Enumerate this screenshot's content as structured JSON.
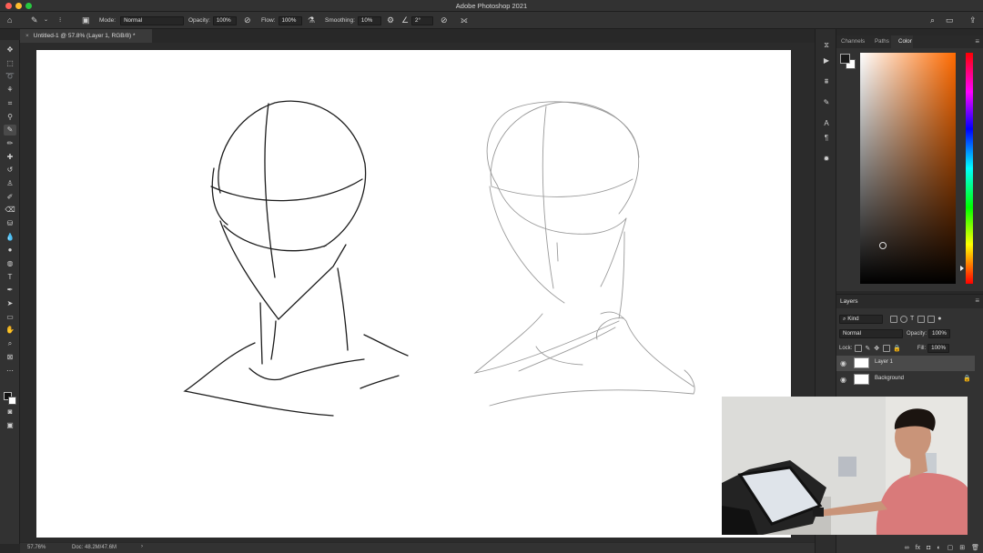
{
  "app": {
    "title": "Adobe Photoshop 2021"
  },
  "options_bar": {
    "mode_label": "Mode:",
    "mode_value": "Normal",
    "opacity_label": "Opacity:",
    "opacity_value": "100%",
    "flow_label": "Flow:",
    "flow_value": "100%",
    "smoothing_label": "Smoothing:",
    "smoothing_value": "10%",
    "angle_value": "2°"
  },
  "document": {
    "tab_title": "Untitled-1 @ 57.8% (Layer 1, RGB/8) *"
  },
  "status": {
    "zoom": "57.76%",
    "doc_info": "Doc: 48.2M/47.6M"
  },
  "color_panel": {
    "tabs": [
      "Channels",
      "Paths",
      "Color"
    ],
    "active_tab": "Color",
    "foreground": "#1a1a1a",
    "background": "#ffffff",
    "hue": "#ff6a00"
  },
  "layers_panel": {
    "title": "Layers",
    "filter_value": "Kind",
    "blend_mode": "Normal",
    "opacity_label": "Opacity:",
    "opacity_value": "100%",
    "lock_label": "Lock:",
    "fill_label": "Fill:",
    "fill_value": "100%",
    "layers": [
      {
        "name": "Layer 1",
        "selected": true
      },
      {
        "name": "Background",
        "selected": false
      }
    ]
  },
  "webcam": {
    "description_icon": "webcam-overlay"
  }
}
